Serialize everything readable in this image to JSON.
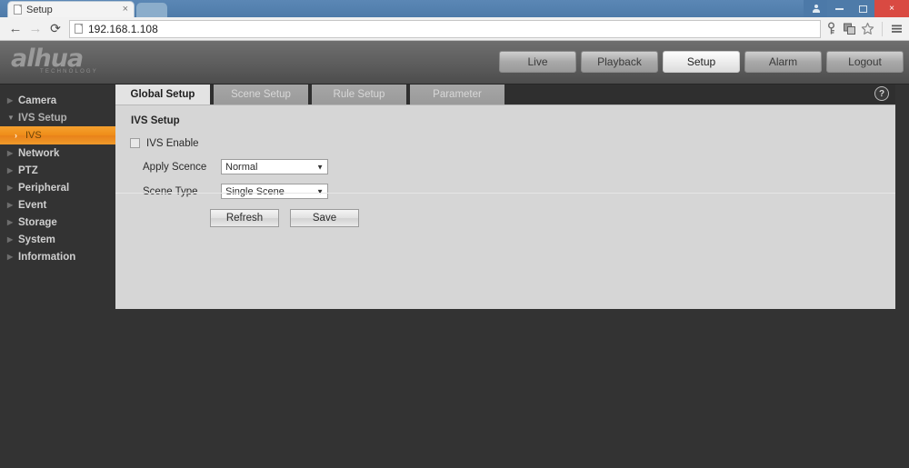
{
  "browser": {
    "tab": {
      "title": "Setup",
      "close_label": "×",
      "favicon": "page-icon"
    },
    "nav": {
      "back": "←",
      "forward": "→",
      "reload": "⟳"
    },
    "omnibox": {
      "url": "192.168.1.108",
      "icon": "page-icon"
    },
    "toolbar_icons": [
      "key-icon",
      "extensions-icon",
      "bookmark-star-icon",
      "menu-hamburger-icon"
    ],
    "window_controls": {
      "user": "person-icon",
      "minimize": "–",
      "maximize": "❐",
      "close": "×"
    }
  },
  "app": {
    "logo": {
      "name": "alhua",
      "tagline": "TECHNOLOGY"
    },
    "mainnav": [
      {
        "label": "Live",
        "active": false
      },
      {
        "label": "Playback",
        "active": false
      },
      {
        "label": "Setup",
        "active": true
      },
      {
        "label": "Alarm",
        "active": false
      },
      {
        "label": "Logout",
        "active": false
      }
    ]
  },
  "sidebar": {
    "items": [
      {
        "label": "Camera",
        "arrow": "▶",
        "state": "collapsed"
      },
      {
        "label": "IVS Setup",
        "arrow": "▼",
        "state": "expanded"
      },
      {
        "label": "Network",
        "arrow": "▶",
        "state": "collapsed"
      },
      {
        "label": "PTZ",
        "arrow": "▶",
        "state": "collapsed"
      },
      {
        "label": "Peripheral",
        "arrow": "▶",
        "state": "collapsed"
      },
      {
        "label": "Event",
        "arrow": "▶",
        "state": "collapsed"
      },
      {
        "label": "Storage",
        "arrow": "▶",
        "state": "collapsed"
      },
      {
        "label": "System",
        "arrow": "▶",
        "state": "collapsed"
      },
      {
        "label": "Information",
        "arrow": "▶",
        "state": "collapsed"
      }
    ],
    "submenu": {
      "label": "IVS",
      "chevron": "›",
      "selected": true
    }
  },
  "tabs": [
    {
      "label": "Global Setup",
      "active": true
    },
    {
      "label": "Scene Setup",
      "active": false
    },
    {
      "label": "Rule Setup",
      "active": false
    },
    {
      "label": "Parameter",
      "active": false
    }
  ],
  "help": {
    "glyph": "?"
  },
  "panel": {
    "heading": "IVS Setup",
    "ivs_enable": {
      "label": "IVS Enable",
      "checked": false
    },
    "apply_scence": {
      "label": "Apply Scence",
      "value": "Normal",
      "caret": "▼"
    },
    "scene_type": {
      "label": "Scene Type",
      "value": "Single Scene",
      "caret": "▼"
    },
    "buttons": {
      "refresh": "Refresh",
      "save": "Save"
    }
  },
  "colors": {
    "accent_orange": "#ef8e1a",
    "app_dark": "#333333",
    "panel_gray": "#d6d6d6",
    "header_gray": "#5d5d5d",
    "browser_blue": "#4e7ba9",
    "close_red": "#d94a42"
  }
}
